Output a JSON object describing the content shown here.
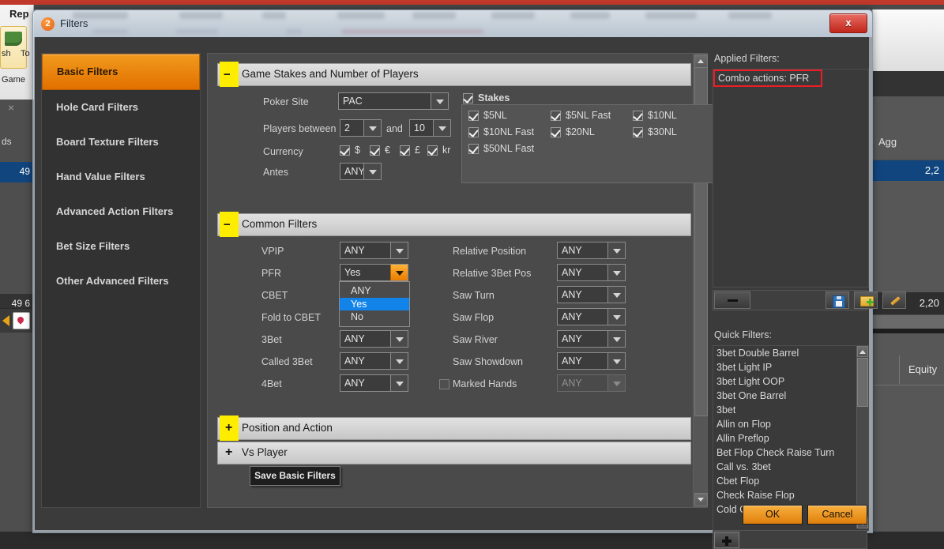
{
  "background": {
    "window_title": "Rep",
    "tile_label": "sh",
    "tile_label2": "To",
    "game_label": "Game",
    "close_glyph": "×",
    "left_col_label": "ds",
    "left_selected_value": "49",
    "left_total_value": "49 6",
    "right_col_label": "Agg",
    "right_selected_value": "2,2",
    "right_total_value": "2,20",
    "equity_label": "Equity"
  },
  "titlebar": {
    "badge": "2",
    "title": "Filters",
    "close_label": "x"
  },
  "sidebar": {
    "items": [
      {
        "label": "Basic Filters",
        "active": true
      },
      {
        "label": "Hole Card Filters",
        "active": false
      },
      {
        "label": "Board Texture Filters",
        "active": false
      },
      {
        "label": "Hand Value Filters",
        "active": false
      },
      {
        "label": "Advanced Action Filters",
        "active": false
      },
      {
        "label": "Bet Size Filters",
        "active": false
      },
      {
        "label": "Other Advanced Filters",
        "active": false
      }
    ]
  },
  "sections": {
    "game_stakes": {
      "title": "Game Stakes and Number of Players",
      "toggle": "−",
      "expanded": true,
      "poker_site_label": "Poker Site",
      "poker_site_value": "PAC",
      "players_label": "Players between",
      "players_min": "2",
      "players_and": "and",
      "players_max": "10",
      "currency_label": "Currency",
      "currencies": [
        {
          "symbol": "$",
          "checked": true
        },
        {
          "symbol": "€",
          "checked": true
        },
        {
          "symbol": "£",
          "checked": true
        },
        {
          "symbol": "kr",
          "checked": true
        }
      ],
      "antes_label": "Antes",
      "antes_value": "ANY",
      "stakes_group_label": "Stakes",
      "stakes_group_checked": true,
      "stakes": [
        {
          "label": "$5NL",
          "checked": true
        },
        {
          "label": "$5NL Fast",
          "checked": true
        },
        {
          "label": "$10NL",
          "checked": true
        },
        {
          "label": "$10NL Fast",
          "checked": true
        },
        {
          "label": "$20NL",
          "checked": true
        },
        {
          "label": "$30NL",
          "checked": true
        },
        {
          "label": "$50NL Fast",
          "checked": true
        }
      ]
    },
    "common_filters": {
      "title": "Common Filters",
      "toggle": "−",
      "left_rows": [
        {
          "label": "VPIP",
          "value": "ANY",
          "open": false
        },
        {
          "label": "PFR",
          "value": "Yes",
          "open": true
        },
        {
          "label": "CBET",
          "value": "ANY",
          "open": false
        },
        {
          "label": "Fold to CBET",
          "value": "ANY",
          "open": false
        },
        {
          "label": "3Bet",
          "value": "ANY",
          "open": false
        },
        {
          "label": "Called 3Bet",
          "value": "ANY",
          "open": false
        },
        {
          "label": "4Bet",
          "value": "ANY",
          "open": false
        }
      ],
      "right_rows": [
        {
          "label": "Relative Position",
          "value": "ANY",
          "disabled": false
        },
        {
          "label": "Relative 3Bet Pos",
          "value": "ANY",
          "disabled": false
        },
        {
          "label": "Saw Turn",
          "value": "ANY",
          "disabled": false
        },
        {
          "label": "Saw Flop",
          "value": "ANY",
          "disabled": false
        },
        {
          "label": "Saw River",
          "value": "ANY",
          "disabled": false
        },
        {
          "label": "Saw Showdown",
          "value": "ANY",
          "disabled": false
        },
        {
          "label": "Marked Hands",
          "value": "ANY",
          "disabled": true,
          "checkbox": true,
          "checked": false
        }
      ],
      "dropdown_options": [
        "ANY",
        "Yes",
        "No"
      ],
      "dropdown_selected": "Yes"
    },
    "position_and_action": {
      "title": "Position and Action",
      "toggle": "+",
      "expanded": false
    },
    "vs_player": {
      "title": "Vs Player",
      "toggle": "+",
      "expanded": false
    }
  },
  "footer": {
    "save_basic_filters": "Save Basic Filters",
    "help": "?"
  },
  "right_panel": {
    "applied_filters_label": "Applied Filters:",
    "applied_filters": [
      "Combo actions: PFR"
    ],
    "highlight_color": "#ee1c25",
    "tools": [
      {
        "name": "remove-filter-button",
        "icon": "minus-icon"
      },
      {
        "name": "save-filter-button",
        "icon": "floppy-disk-icon"
      },
      {
        "name": "load-filter-button",
        "icon": "folder-add-icon"
      },
      {
        "name": "edit-filter-button",
        "icon": "pencil-icon"
      }
    ],
    "quick_filters_label": "Quick Filters:",
    "quick_filters": [
      "3bet Double Barrel",
      "3bet Light IP",
      "3bet Light OOP",
      "3bet One Barrel",
      "3bet",
      "Allin on Flop",
      "Allin Preflop",
      "Bet Flop Check Raise Turn",
      "Call vs. 3bet",
      "Cbet Flop",
      "Check Raise Flop",
      "Cold Call Pre Flop"
    ],
    "add_button_icon": "plus-icon"
  },
  "dialog_buttons": {
    "ok": "OK",
    "cancel": "Cancel"
  },
  "colors": {
    "accent_orange": "#e8820c",
    "selection_blue": "#1283e8",
    "highlight_yellow": "#ffed00",
    "alert_red": "#ee1c25"
  }
}
